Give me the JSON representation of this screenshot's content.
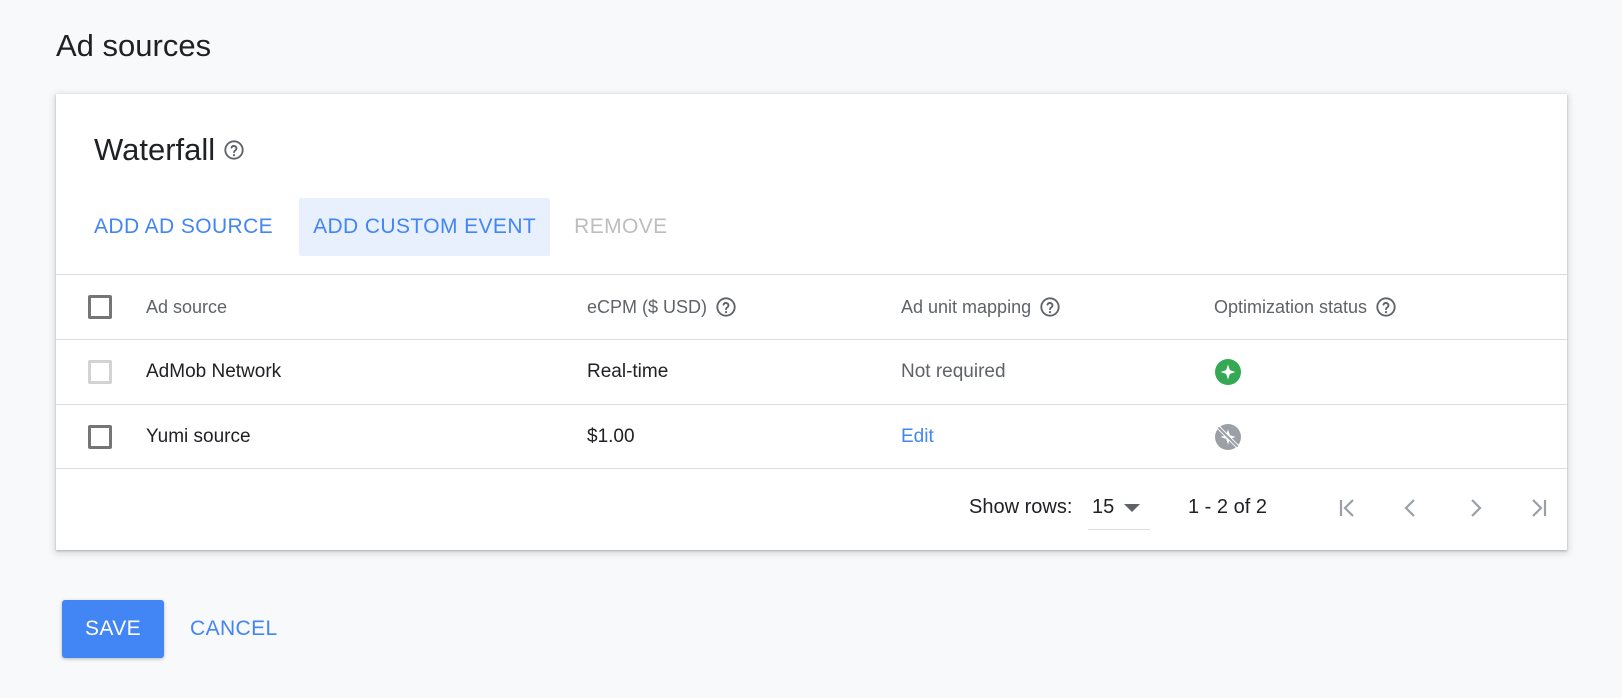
{
  "page": {
    "title": "Ad sources"
  },
  "waterfall": {
    "title": "Waterfall",
    "toolbar": {
      "add_ad_source": "ADD AD SOURCE",
      "add_custom_event": "ADD CUSTOM EVENT",
      "remove": "REMOVE"
    },
    "table": {
      "headers": {
        "ad_source": "Ad source",
        "ecpm": "eCPM ($ USD)",
        "mapping": "Ad unit mapping",
        "optimization": "Optimization status"
      },
      "rows": [
        {
          "ad_source": "AdMob Network",
          "ecpm": "Real-time",
          "mapping": "Not required",
          "status_icon": "optimized-sparkle-icon",
          "status_color": "#34a853"
        },
        {
          "ad_source": "Yumi source",
          "ecpm": "$1.00",
          "mapping": "Edit",
          "status_icon": "optimization-off-icon",
          "status_color": "#9aa0a6"
        }
      ]
    },
    "pagination": {
      "show_rows_label": "Show rows:",
      "rows_per_page": "15",
      "range": "1 - 2 of 2"
    }
  },
  "footer": {
    "save": "SAVE",
    "cancel": "CANCEL"
  },
  "colors": {
    "accent": "#4285f4",
    "background": "#f8f9fa",
    "active_bg": "#e8f0fe"
  }
}
